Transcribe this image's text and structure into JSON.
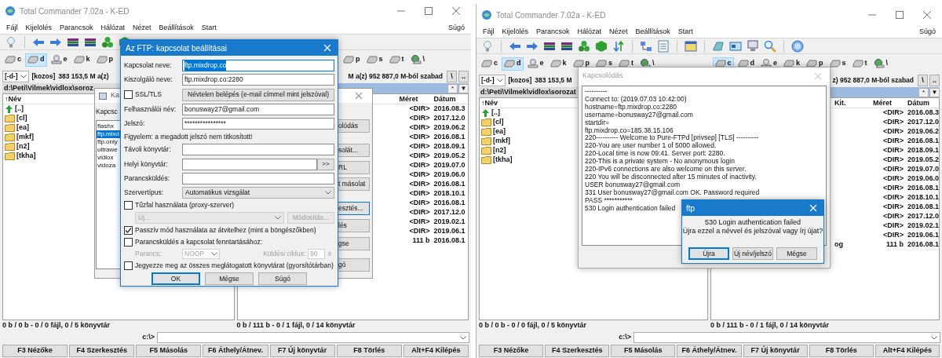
{
  "windows": [
    {
      "title": "Total Commander 7.02a - K-ED",
      "menu": [
        "Fájl",
        "Kijelölés",
        "Parancsok",
        "Hálózat",
        "Nézet",
        "Beállítások",
        "Start"
      ],
      "help_menu": "Súgó",
      "drives_left": [
        {
          "letter": "c",
          "kind": "disk",
          "selected": false
        },
        {
          "letter": "d",
          "kind": "disk",
          "selected": true
        },
        {
          "letter": "e",
          "kind": "cd",
          "selected": false
        },
        {
          "letter": "k",
          "kind": "disk",
          "selected": false
        },
        {
          "letter": "p",
          "kind": "disk",
          "selected": false
        }
      ],
      "drives_right": [
        {
          "letter": "p",
          "kind": "disk",
          "selected": false
        },
        {
          "letter": "s",
          "kind": "disk",
          "selected": false
        },
        {
          "letter": "t",
          "kind": "disk",
          "selected": false
        },
        {
          "letter": "\\",
          "kind": "net",
          "selected": false
        }
      ],
      "drive_combo": "[-d-]",
      "volume": "[kozos]",
      "free_left": "383 153,5 M a(z)",
      "free_right": "M a(z) 952 887,0 M-ból szabad",
      "nav_buttons": [
        "\\",
        ".."
      ],
      "left_panel": {
        "path": "d:\\Peti\\Vilmek\\vidlox\\soroz",
        "active": false,
        "header": "↑Név",
        "files": [
          {
            "kind": "up",
            "name": "[..]"
          },
          {
            "kind": "folder",
            "name": "[cl]"
          },
          {
            "kind": "folder",
            "name": "[ea]"
          },
          {
            "kind": "folder",
            "name": "[mkf]"
          },
          {
            "kind": "folder",
            "name": "[n2]"
          },
          {
            "kind": "folder",
            "name": "[tkha]"
          }
        ]
      },
      "right_panel": {
        "active": true,
        "path_buttons": [
          "*",
          "▼"
        ],
        "columns": [
          {
            "kind": "size",
            "label": "Méret"
          },
          {
            "kind": "date",
            "label": "Dátum"
          }
        ],
        "rows": [
          {
            "size": "<DIR>",
            "date": "2016.08.3"
          },
          {
            "size": "<DIR>",
            "date": "2017.12.0"
          },
          {
            "size": "<DIR>",
            "date": "2019.06.2"
          },
          {
            "size": "<DIR>",
            "date": "2016.08.1"
          },
          {
            "size": "<DIR>",
            "date": "2018.09.1"
          },
          {
            "size": "<DIR>",
            "date": "2019.05.2"
          },
          {
            "size": "<DIR>",
            "date": "2019.07.0"
          },
          {
            "size": "<DIR>",
            "date": "2019.06.0"
          },
          {
            "size": "<DIR>",
            "date": "2016.08.1"
          },
          {
            "size": "<DIR>",
            "date": "2018.10.1"
          },
          {
            "size": "<DIR>",
            "date": "2016.08.1"
          },
          {
            "size": "<DIR>",
            "date": "2017.12.0"
          },
          {
            "size": "<DIR>",
            "date": "2019.02.1"
          },
          {
            "size": "<DIR>",
            "date": "2019.06.1"
          },
          {
            "size": "111 b",
            "date": "2016.08.1"
          }
        ]
      },
      "status_left": "0 b / 0 b - 0 / 0 fájl, 0 / 5 könyvtár",
      "status_right": "0 b / 111 b - 0 / 1 fájl, 0 / 14 könyvtár",
      "cmd_prompt": "c:\\>",
      "fkeys": [
        "F3 Nézőke",
        "F4 Szerkesztés",
        "F5 Másolás",
        "F6 Áthely/Átnev.",
        "F7 Új könyvtár",
        "F8 Törlés",
        "Alt+F4 Kilépés"
      ],
      "dialogs": [
        {
          "kind": "connect",
          "title": "Ka",
          "label": "Kapcsc",
          "servers": [
            {
              "name": "flashx",
              "selected": false
            },
            {
              "name": "ftp.mixd",
              "selected": true
            },
            {
              "name": "ftp.only",
              "selected": false
            },
            {
              "name": "ultrawe",
              "selected": false
            },
            {
              "name": "vidlox",
              "selected": false
            },
            {
              "name": "vidoza",
              "selected": false
            }
          ],
          "buttons": [
            {
              "label": "olódás",
              "default": false
            },
            {
              "label": "solát...",
              "default": false
            },
            {
              "label": "RL",
              "default": false
            },
            {
              "label": "t másolat",
              "default": false
            },
            {
              "label": "esztés...",
              "default": true
            },
            {
              "label": "lés",
              "default": false
            },
            {
              "label": "gse",
              "default": false
            },
            {
              "label": "gó",
              "default": false
            }
          ]
        },
        {
          "kind": "ftp_settings",
          "title": "Az FTP: kapcsolat beállításai",
          "rows": [
            {
              "kind": "text",
              "label": "Kapcsolat neve:",
              "value": "ftp.mixdrop.co",
              "text_selected": true
            },
            {
              "kind": "text",
              "label": "Kiszolgáló neve:",
              "value": "ftp.mixdrop.co:2280",
              "text_selected": false
            },
            {
              "kind": "check_button",
              "label": "SSL/TLS",
              "checked": false,
              "button": "Névtelen belépés (e-mail címmel mint jelszóval)"
            },
            {
              "kind": "text",
              "label": "Felhasználói név:",
              "value": "bonusway27@gmail.com",
              "text_selected": false
            },
            {
              "kind": "text",
              "label": "Jelszó:",
              "value": "****************",
              "text_selected": false
            },
            {
              "kind": "note",
              "label": "Figyelem: a megadott jelszó nem titkosított!"
            },
            {
              "kind": "text",
              "label": "Távoli könyvtár:"
            },
            {
              "kind": "browse",
              "label": "Helyi könyvtár:",
              "button": ">>"
            },
            {
              "kind": "text",
              "label": "Parancsküldés:"
            },
            {
              "kind": "select",
              "label": "Szervertípus:",
              "value": "Automatikus vizsgálat"
            },
            {
              "kind": "check",
              "label": "Tűzfal használata (proxy-szerver)",
              "checked": false
            },
            {
              "kind": "proxy",
              "value": "Új...",
              "button": "Módosítás...",
              "disabled": true
            },
            {
              "kind": "check",
              "label": "Passzív mód használata az átvitelhez (mint a böngészőkben)",
              "checked": true
            },
            {
              "kind": "check",
              "label": "Parancsküldés a kapcsolat fenntartásához:",
              "checked": false
            },
            {
              "kind": "keepalive",
              "label": "Parancs:",
              "value": "NOOP",
              "label2": "Küldési ciklus:",
              "value2": "90",
              "unit": "s",
              "disabled": true
            },
            {
              "kind": "check",
              "label": "Jegyezze meg az összes meglátogatott könyvtárat (gyorsítótárban)",
              "checked": false
            }
          ],
          "buttons": [
            {
              "label": "OK",
              "default": true
            },
            {
              "label": "Mégse",
              "default": false
            },
            {
              "label": "Súgó",
              "default": false
            }
          ]
        }
      ]
    },
    {
      "title": "Total Commander 7.02a - K-ED",
      "menu": [
        "Fájl",
        "Kijelölés",
        "Parancsok",
        "Hálózat",
        "Nézet",
        "Beállítások",
        "Start"
      ],
      "help_menu": "Súgó",
      "drives_left": [
        {
          "letter": "c",
          "kind": "disk",
          "selected": false
        },
        {
          "letter": "d",
          "kind": "disk",
          "selected": true
        },
        {
          "letter": "e",
          "kind": "cd",
          "selected": false
        },
        {
          "letter": "k",
          "kind": "disk",
          "selected": false
        },
        {
          "letter": "p",
          "kind": "disk",
          "selected": false
        },
        {
          "letter": "s",
          "kind": "disk",
          "selected": false
        },
        {
          "letter": "t",
          "kind": "disk",
          "selected": false
        },
        {
          "letter": "\\",
          "kind": "net",
          "selected": false
        }
      ],
      "drives_right": [
        {
          "letter": "c",
          "kind": "disk",
          "selected": true
        },
        {
          "letter": "d",
          "kind": "disk",
          "selected": false
        },
        {
          "letter": "e",
          "kind": "cd",
          "selected": false
        },
        {
          "letter": "k",
          "kind": "disk",
          "selected": false
        },
        {
          "letter": "p",
          "kind": "disk",
          "selected": false
        },
        {
          "letter": "s",
          "kind": "disk",
          "selected": false
        },
        {
          "letter": "t",
          "kind": "disk",
          "selected": false
        },
        {
          "letter": "\\",
          "kind": "net",
          "selected": false
        }
      ],
      "drive_combo": "[-d-]",
      "volume": "[kozos]",
      "free_left": "383 153,5 M",
      "free_right": "z) 952 887,0 M-ból szabad",
      "nav_buttons": [
        "\\",
        ".."
      ],
      "left_panel": {
        "path": "d:\\Peti\\Vilmek\\vidlox\\sorozat",
        "active": false,
        "header": "↑Név",
        "files": [
          {
            "kind": "up",
            "name": "[..]"
          },
          {
            "kind": "folder",
            "name": "[cl]"
          },
          {
            "kind": "folder",
            "name": "[ea]"
          },
          {
            "kind": "folder",
            "name": "[mkf]"
          },
          {
            "kind": "folder",
            "name": "[n2]"
          },
          {
            "kind": "folder",
            "name": "[tkha]"
          }
        ]
      },
      "right_panel": {
        "active": true,
        "path_buttons": [
          "*",
          "▼"
        ],
        "columns": [
          {
            "kind": "ext",
            "label": "Kit."
          },
          {
            "kind": "size",
            "label": "Méret"
          },
          {
            "kind": "date",
            "label": "Dátum"
          }
        ],
        "rows": [
          {
            "size": "<DIR>",
            "date": "2016.08.3"
          },
          {
            "size": "<DIR>",
            "date": "2017.12.0"
          },
          {
            "size": "<DIR>",
            "date": "2019.06.2"
          },
          {
            "size": "<DIR>",
            "date": "2016.08.1"
          },
          {
            "size": "<DIR>",
            "date": "2018.09.1"
          },
          {
            "size": "<DIR>",
            "date": "2019.05.2"
          },
          {
            "size": "<DIR>",
            "date": "2019.07.0"
          },
          {
            "size": "<DIR>",
            "date": "2019.06.0"
          },
          {
            "size": "<DIR>",
            "date": "2016.08.1"
          },
          {
            "size": "<DIR>",
            "date": "2018.10.1"
          },
          {
            "size": "<DIR>",
            "date": "2016.08.1"
          },
          {
            "size": "<DIR>",
            "date": "2017.12.0"
          },
          {
            "size": "<DIR>",
            "date": "2019.02.1"
          },
          {
            "size": "<DIR>",
            "date": "2019.06.1"
          },
          {
            "ext": "og",
            "size": "111 b",
            "date": "2016.08.1"
          }
        ]
      },
      "status_left": "0 b / 0 b - 0 / 0 fájl, 0 / 5 könyvtár",
      "status_right": "0 b / 111 b - 0 / 1 fájl, 0 / 14 könyvtár",
      "cmd_prompt": "c:\\>",
      "fkeys": [
        "F3 Nézőke",
        "F4 Szerkesztés",
        "F5 Másolás",
        "F6 Áthely/Átnev.",
        "F7 Új könyvtár",
        "F8 Törlés",
        "Alt+F4 Kilépés"
      ],
      "dialogs": [
        {
          "kind": "log",
          "title": "Kapcsolódás",
          "lines": [
            "----------",
            "Connect to: (2019.07.03 10:42:00)",
            "hostname=ftp.mixdrop.co:2280",
            "username=bonusway27@gmail.com",
            "startdir=",
            "ftp.mixdrop.co=185.38.15.106",
            "220---------- Welcome to Pure-FTPd [privsep] [TLS] ----------",
            "220-You are user number 1 of 5000 allowed.",
            "220-Local time is now 09:41. Server port: 2280.",
            "220-This is a private system - No anonymous login",
            "220-IPv6 connections are also welcome on this server.",
            "220 You will be disconnected after 15 minutes of inactivity.",
            "USER bonusway27@gmail.com",
            "331 User bonusway27@gmail.com OK. Password required",
            "PASS ***********",
            "530 Login authentication failed"
          ]
        },
        {
          "kind": "message",
          "title": "ftp",
          "lines": [
            "530 Login authentication failed",
            "Újra ezzel a névvel és jelszóval vagy írj újat?"
          ],
          "buttons": [
            {
              "label": "Újra",
              "default": true
            },
            {
              "label": "Új név/jelszó",
              "default": false
            },
            {
              "label": "Mégse",
              "default": false
            }
          ]
        }
      ]
    }
  ]
}
